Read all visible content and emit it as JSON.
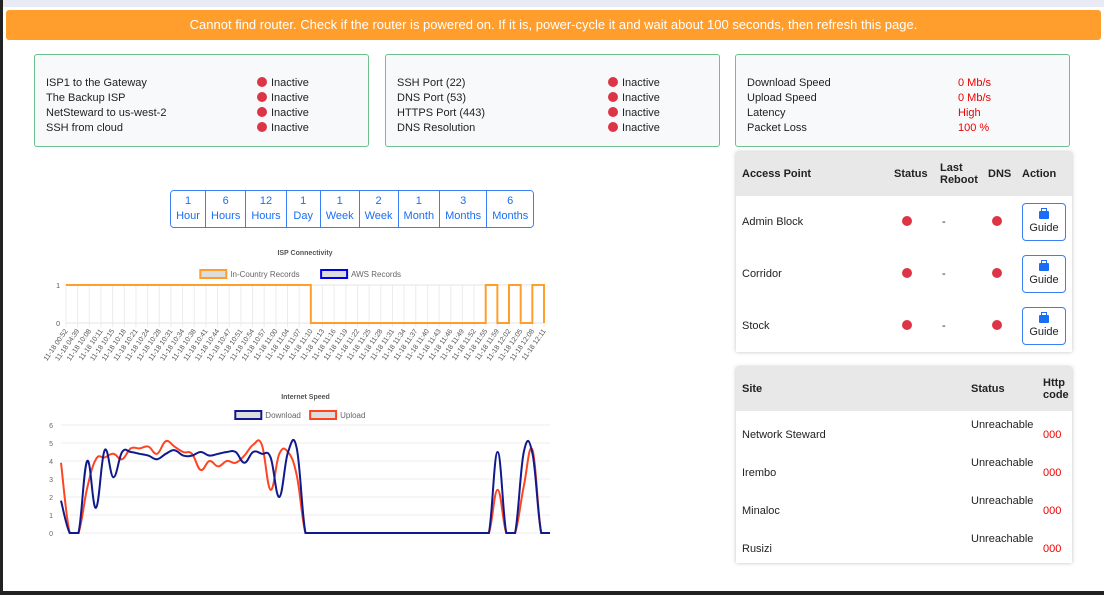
{
  "banner": "Cannot find router. Check if the router is powered on. If it is, power-cycle it and wait about 100 seconds, then refresh this page.",
  "colors": {
    "banner": "#ff9e2c",
    "inactive": "#dc3545",
    "card_border": "#6dbf8e",
    "accent": "#1a6ef5"
  },
  "card1": [
    {
      "label": "ISP1 to the Gateway",
      "status": "Inactive"
    },
    {
      "label": "The Backup ISP",
      "status": "Inactive"
    },
    {
      "label": "NetSteward to us-west-2",
      "status": "Inactive"
    },
    {
      "label": "SSH from cloud",
      "status": "Inactive"
    }
  ],
  "card2": [
    {
      "label": "SSH Port (22)",
      "status": "Inactive"
    },
    {
      "label": "DNS Port (53)",
      "status": "Inactive"
    },
    {
      "label": "HTTPS Port (443)",
      "status": "Inactive"
    },
    {
      "label": "DNS Resolution",
      "status": "Inactive"
    }
  ],
  "card3": [
    {
      "label": "Download Speed",
      "value": "0 Mb/s"
    },
    {
      "label": "Upload Speed",
      "value": "0 Mb/s"
    },
    {
      "label": "Latency",
      "value": "High"
    },
    {
      "label": "Packet Loss",
      "value": "100 %"
    }
  ],
  "ranges": [
    {
      "n": "1",
      "u": "Hour"
    },
    {
      "n": "6",
      "u": "Hours"
    },
    {
      "n": "12",
      "u": "Hours"
    },
    {
      "n": "1",
      "u": "Day"
    },
    {
      "n": "1",
      "u": "Week"
    },
    {
      "n": "2",
      "u": "Week"
    },
    {
      "n": "1",
      "u": "Month"
    },
    {
      "n": "3",
      "u": "Months"
    },
    {
      "n": "6",
      "u": "Months"
    }
  ],
  "ap_table": {
    "headers": [
      "Access Point",
      "Status",
      "Last Reboot",
      "DNS",
      "Action"
    ],
    "rows": [
      {
        "name": "Admin Block",
        "last_reboot": "-",
        "action": "Guide"
      },
      {
        "name": "Corridor",
        "last_reboot": "-",
        "action": "Guide"
      },
      {
        "name": "Stock",
        "last_reboot": "-",
        "action": "Guide"
      }
    ]
  },
  "site_table": {
    "headers": [
      "Site",
      "Status",
      "Http code"
    ],
    "rows": [
      {
        "site": "Network Steward",
        "status": "Unreachable",
        "code": "000"
      },
      {
        "site": "Irembo",
        "status": "Unreachable",
        "code": "000"
      },
      {
        "site": "Minaloc",
        "status": "Unreachable",
        "code": "000"
      },
      {
        "site": "Rusizi",
        "status": "Unreachable",
        "code": "000"
      }
    ]
  },
  "chart_data": [
    {
      "type": "line",
      "title": "ISP Connectivity",
      "step": true,
      "ylim": [
        0,
        1
      ],
      "yticks": [
        0,
        1
      ],
      "legend_position": "top",
      "grid": true,
      "categories": [
        "11-18 00:52",
        "11-18 04:39",
        "11-18 10:08",
        "11-18 10:11",
        "11-18 10:15",
        "11-18 10:18",
        "11-18 10:21",
        "11-18 10:24",
        "11-18 10:28",
        "11-18 10:31",
        "11-18 10:34",
        "11-18 10:38",
        "11-18 10:41",
        "11-18 10:44",
        "11-18 10:47",
        "11-18 10:51",
        "11-18 10:54",
        "11-18 10:57",
        "11-18 11:00",
        "11-18 11:04",
        "11-18 11:07",
        "11-18 11:10",
        "11-18 11:13",
        "11-18 11:16",
        "11-18 11:19",
        "11-18 11:22",
        "11-18 11:25",
        "11-18 11:28",
        "11-18 11:31",
        "11-18 11:34",
        "11-18 11:37",
        "11-18 11:40",
        "11-18 11:43",
        "11-18 11:46",
        "11-18 11:49",
        "11-18 11:52",
        "11-18 11:55",
        "11-18 11:59",
        "11-18 12:02",
        "11-18 12:05",
        "11-18 12:08",
        "11-18 12:11"
      ],
      "series": [
        {
          "name": "In-Country Records",
          "color": "#ff9e2c",
          "values": [
            1,
            1,
            1,
            1,
            1,
            1,
            1,
            1,
            1,
            1,
            1,
            1,
            1,
            1,
            1,
            1,
            1,
            1,
            1,
            1,
            1,
            0,
            0,
            0,
            0,
            0,
            0,
            0,
            0,
            0,
            0,
            0,
            0,
            0,
            0,
            0,
            1,
            0,
            1,
            0,
            1,
            0
          ]
        },
        {
          "name": "AWS Records",
          "color": "#0000ee",
          "values": []
        }
      ]
    },
    {
      "type": "line",
      "title": "Internet Speed",
      "ylim": [
        0,
        6
      ],
      "yticks": [
        0,
        1,
        2,
        3,
        4,
        5,
        6
      ],
      "legend_position": "top",
      "grid": true,
      "series": [
        {
          "name": "Download",
          "color": "#101a8c",
          "values": [
            1.8,
            0,
            0,
            4.0,
            1.4,
            4.6,
            3.1,
            4.5,
            4.5,
            4.4,
            4.3,
            4.1,
            4.4,
            4.6,
            4.3,
            4.3,
            4.5,
            4.3,
            4.4,
            4.5,
            4.5,
            3.9,
            4.5,
            4.4,
            4.2,
            2.0,
            4.5,
            4.7,
            0,
            0,
            0,
            0,
            0,
            0,
            0,
            0,
            0,
            0,
            0,
            0,
            0,
            0,
            0,
            0,
            0,
            0,
            0,
            0,
            0,
            0,
            4.5,
            0,
            0,
            4.5,
            4.4,
            0,
            0
          ]
        },
        {
          "name": "Upload",
          "color": "#ff4422",
          "values": [
            3.9,
            0,
            0,
            2.5,
            4.1,
            4.2,
            4.4,
            4.1,
            4.7,
            4.7,
            4.8,
            4.4,
            5.1,
            4.8,
            4.5,
            4.4,
            3.5,
            4.0,
            3.7,
            4.0,
            3.9,
            4.3,
            4.9,
            4.9,
            2.4,
            4.4,
            4.5,
            3.2,
            0,
            0,
            0,
            0,
            0,
            0,
            0,
            0,
            0,
            0,
            0,
            0,
            0,
            0,
            0,
            0,
            0,
            0,
            0,
            0,
            0,
            0,
            2.4,
            0,
            0,
            2.6,
            4.6,
            0,
            0
          ]
        }
      ]
    }
  ]
}
